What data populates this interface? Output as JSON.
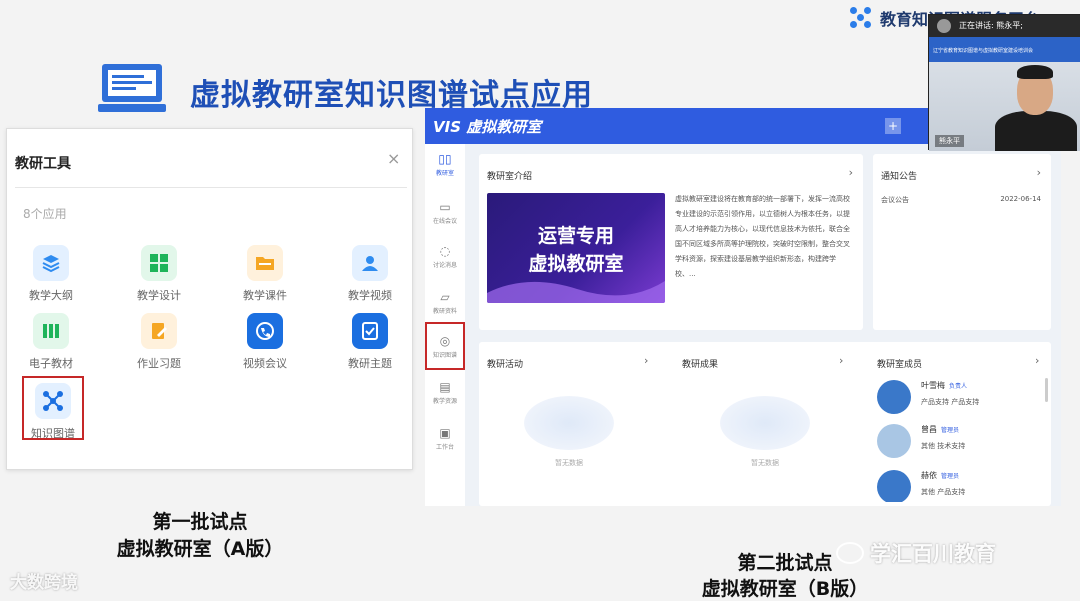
{
  "slide": {
    "brand": "教育知识图谱服务平台",
    "title": "虚拟教研室知识图谱试点应用",
    "caption_a_line1": "第一批试点",
    "caption_a_line2": "虚拟教研室（A版）",
    "caption_b_line1": "第二批试点",
    "caption_b_line2": "虚拟教研室（B版）"
  },
  "panel_a": {
    "title": "教研工具",
    "close": "×",
    "count": "8个应用",
    "apps": [
      {
        "label": "教学大纲",
        "icon": "layers-icon",
        "color": "#2f8cf0"
      },
      {
        "label": "教学设计",
        "icon": "grid-icon",
        "color": "#1eb45a"
      },
      {
        "label": "教学课件",
        "icon": "folder-icon",
        "color": "#f5a623"
      },
      {
        "label": "教学视频",
        "icon": "user-icon",
        "color": "#2f8cf0"
      },
      {
        "label": "电子教材",
        "icon": "books-icon",
        "color": "#1eb45a"
      },
      {
        "label": "作业习题",
        "icon": "edit-icon",
        "color": "#f5a623"
      },
      {
        "label": "视频会议",
        "icon": "video-call-icon",
        "color": "#1b6fe0"
      },
      {
        "label": "教研主题",
        "icon": "check-doc-icon",
        "color": "#1b6fe0"
      },
      {
        "label": "知识图谱",
        "icon": "graph-icon",
        "color": "#1b6fe0"
      }
    ]
  },
  "panel_b": {
    "logo": "VIS 虚拟教研室",
    "plus": "+",
    "sidebar": [
      {
        "label": "教研室",
        "icon": "book-icon",
        "active": true
      },
      {
        "label": "在线会议",
        "icon": "camera-icon",
        "active": false
      },
      {
        "label": "讨论消息",
        "icon": "chat-icon",
        "active": false
      },
      {
        "label": "教研资料",
        "icon": "folder-icon",
        "active": false
      },
      {
        "label": "知识图谱",
        "icon": "graph-icon",
        "active": false
      },
      {
        "label": "教学资源",
        "icon": "doc-icon",
        "active": false
      },
      {
        "label": "工作台",
        "icon": "desk-icon",
        "active": false
      }
    ],
    "intro": {
      "title": "教研室介绍",
      "banner_line1": "运营专用",
      "banner_line2": "虚拟教研室",
      "text": "虚拟教研室建设将在教育部的统一部署下，发挥一流高校专业建设的示范引领作用，以立德树人为根本任务，以提高人才培养能力为核心，以现代信息技术为依托，联合全国不同区域多所高等护理院校，突破时空限制，整合交叉学科资源，探索建设基层教学组织新形态，构建跨学校、..."
    },
    "notice": {
      "title": "通知公告",
      "item": "会议公告",
      "date": "2022-06-14"
    },
    "activity": {
      "title": "教研活动",
      "empty": "暂无数据"
    },
    "results": {
      "title": "教研成果",
      "empty": "暂无数据"
    },
    "members": {
      "title": "教研室成员",
      "list": [
        {
          "name": "叶雪梅",
          "role": "负责人",
          "desc": "产品支持 产品支持"
        },
        {
          "name": "曾昌",
          "role": "管理员",
          "desc": "其他 技术支持"
        },
        {
          "name": "赫依",
          "role": "管理员",
          "desc": "其他 产品支持"
        }
      ]
    },
    "chevron": "›"
  },
  "video": {
    "speaking": "正在讲话: 熊永平;",
    "banner": "辽宁省教育知识图谱与虚拟教研室建设培训会",
    "name": "熊永平"
  },
  "watermarks": {
    "left": "大数跨境",
    "right": "学汇百川教育"
  }
}
